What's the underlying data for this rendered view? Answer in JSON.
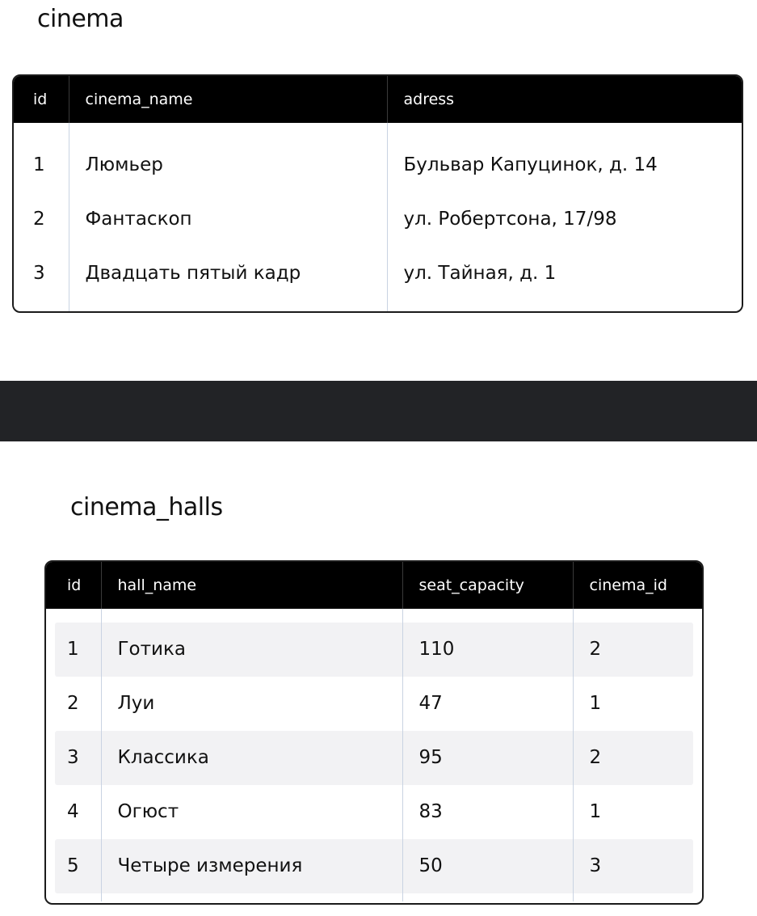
{
  "tables": [
    {
      "title": "cinema",
      "columns": [
        "id",
        "cinema_name",
        "adress"
      ],
      "rows": [
        [
          "1",
          "Люмьер",
          "Бульвар Капуцинок, д. 14"
        ],
        [
          "2",
          "Фантаскоп",
          "ул. Робертсона, 17/98"
        ],
        [
          "3",
          "Двадцать пятый кадр",
          "ул. Тайная, д. 1"
        ]
      ]
    },
    {
      "title": "cinema_halls",
      "columns": [
        "id",
        "hall_name",
        "seat_capacity",
        "cinema_id"
      ],
      "rows": [
        [
          "1",
          "Готика",
          "110",
          "2"
        ],
        [
          "2",
          "Луи",
          "47",
          "1"
        ],
        [
          "3",
          "Классика",
          "95",
          "2"
        ],
        [
          "4",
          "Огюст",
          "83",
          "1"
        ],
        [
          "5",
          "Четыре измерения",
          "50",
          "3"
        ]
      ]
    }
  ],
  "colors": {
    "header_bg": "#000000",
    "divider_band": "#222326",
    "stripe": "#f2f2f4",
    "column_line": "#c9d3e2"
  }
}
